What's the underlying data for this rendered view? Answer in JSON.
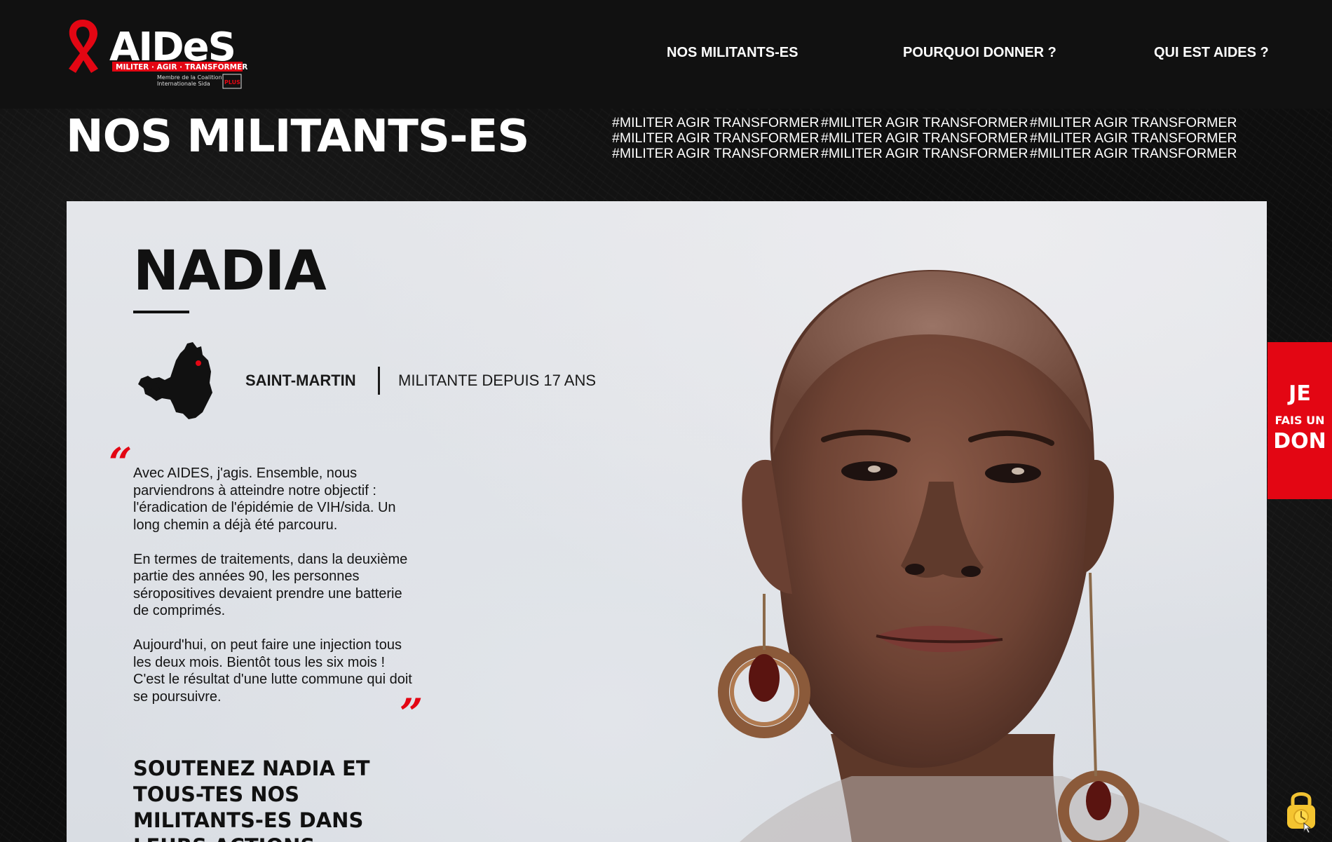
{
  "header": {
    "logo": {
      "brand": "AIDES",
      "tagline": "MILITER · AGIR · TRANSFORMER",
      "membership": "Membre de la Coalition Internationale Sida",
      "partner": "PLUS",
      "icon": "red-ribbon-icon"
    },
    "nav": [
      {
        "label": "NOS MILITANTS-ES"
      },
      {
        "label": "POURQUOI DONNER ?"
      },
      {
        "label": "QUI EST AIDES ?"
      }
    ]
  },
  "hero": {
    "title": "NOS MILITANTS-ES",
    "hashtags": [
      "#MILITER AGIR TRANSFORMER",
      "#MILITER AGIR TRANSFORMER",
      "#MILITER AGIR TRANSFORMER",
      "#MILITER AGIR TRANSFORMER",
      "#MILITER AGIR TRANSFORMER",
      "#MILITER AGIR TRANSFORMER",
      "#MILITER AGIR TRANSFORMER",
      "#MILITER AGIR TRANSFORMER",
      "#MILITER AGIR TRANSFORMER"
    ]
  },
  "profile": {
    "name": "NADIA",
    "location": "SAINT-MARTIN",
    "seniority": "MILITANTE DEPUIS 17 ANS",
    "map_icon": "saint-martin-map-icon",
    "quote_paragraphs": [
      "Avec AIDES, j'agis. Ensemble, nous parviendrons à atteindre notre objectif : l'éradication de l'épidémie de VIH/sida. Un long chemin a déjà été parcouru.",
      "En termes de traitements, dans la deuxième partie des années 90, les personnes séropositives devaient prendre une batterie de comprimés.",
      "Aujourd'hui, on peut faire une injection tous les deux mois. Bientôt tous les six mois ! C'est le résultat d'une lutte commune qui doit se poursuivre."
    ],
    "support_title": "SOUTENEZ NADIA ET TOUS-TES NOS MILITANTS-ES DANS LEURS ACTIONS"
  },
  "cta": {
    "line1": "JE",
    "line2": "FAIS UN",
    "line3": "DON"
  },
  "lock_icon": "padlock-icon",
  "colors": {
    "brand_red": "#e30613",
    "header_bg": "#111111",
    "card_bg": "#e1e4e9",
    "text_dark": "#111111"
  }
}
